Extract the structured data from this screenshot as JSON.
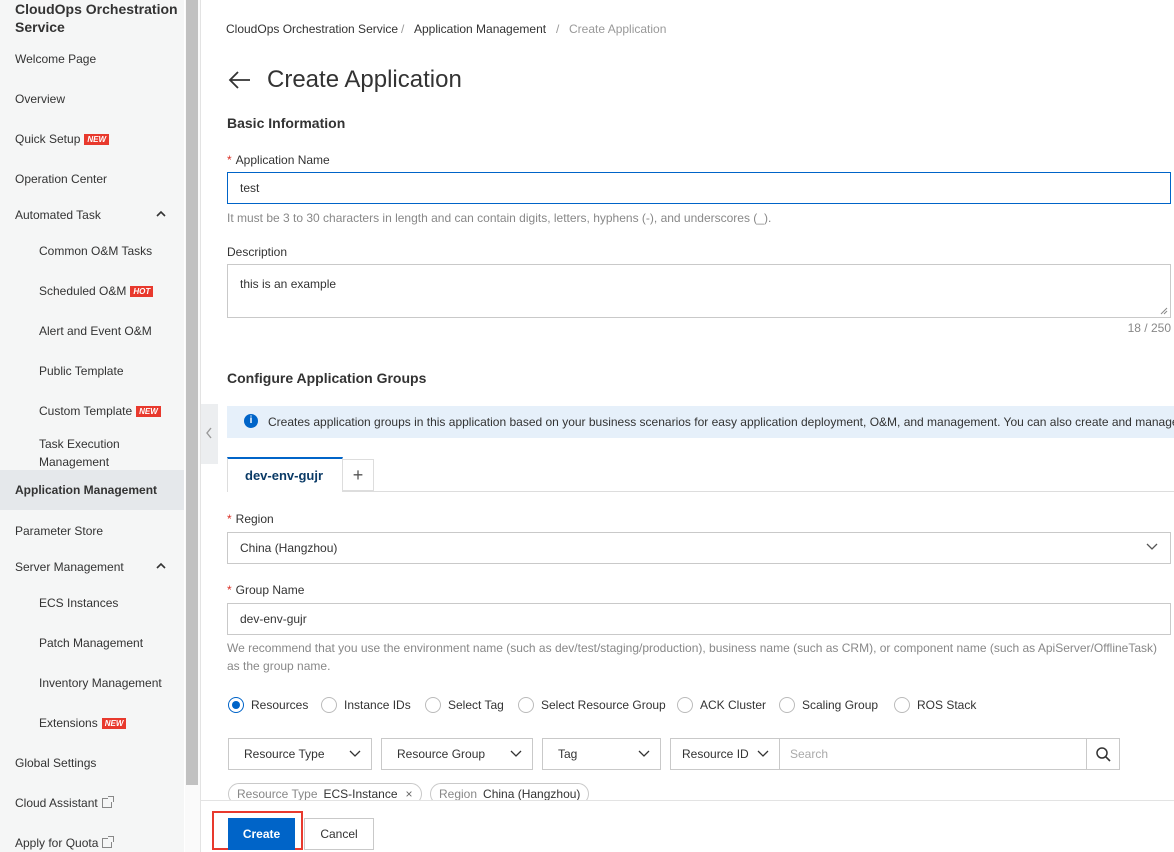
{
  "sidebar": {
    "title": "CloudOps Orchestration Service",
    "items": {
      "welcome": "Welcome Page",
      "overview": "Overview",
      "quick_setup": "Quick Setup",
      "operation_center": "Operation Center",
      "automated_task": "Automated Task",
      "common_om": "Common O&M Tasks",
      "scheduled_om": "Scheduled O&M",
      "alert_event_om": "Alert and Event O&M",
      "public_template": "Public Template",
      "custom_template": "Custom Template",
      "task_exec_line1": "Task Execution",
      "task_exec_line2": "Management",
      "app_management": "Application Management",
      "parameter_store": "Parameter Store",
      "server_management": "Server Management",
      "ecs_instances": "ECS Instances",
      "patch_management": "Patch Management",
      "inventory_management": "Inventory Management",
      "extensions": "Extensions",
      "global_settings": "Global Settings",
      "cloud_assistant": "Cloud Assistant",
      "apply_quota": "Apply for Quota"
    },
    "badges": {
      "new": "NEW",
      "hot": "HOT"
    }
  },
  "breadcrumb": [
    "CloudOps Orchestration Service",
    "Application Management",
    "Create Application"
  ],
  "breadcrumb_sep": "/",
  "page_title": "Create Application",
  "basic_info": {
    "heading": "Basic Information",
    "app_name_label": "Application Name",
    "app_name_value": "test",
    "app_name_help": "It must be 3 to 30 characters in length and can contain digits, letters, hyphens (-), and underscores (_).",
    "description_label": "Description",
    "description_value": "this is an example",
    "description_count": "18 / 250"
  },
  "groups": {
    "heading": "Configure Application Groups",
    "info": "Creates application groups in this application based on your business scenarios for easy application deployment, O&M, and management. You can also create and manage",
    "tab_label": "dev-env-gujr",
    "tab_add": "+",
    "region_label": "Region",
    "region_value": "China (Hangzhou)",
    "group_name_label": "Group Name",
    "group_name_value": "dev-env-gujr",
    "group_name_help": "We recommend that you use the environment name (such as dev/test/staging/production), business name (such as CRM), or component name (such as ApiServer/OfflineTask) as the group name.",
    "radio_options": [
      "Resources",
      "Instance IDs",
      "Select Tag",
      "Select Resource Group",
      "ACK Cluster",
      "Scaling Group",
      "ROS Stack"
    ],
    "radio_selected": "Resources",
    "filters": {
      "resource_type": "Resource Type",
      "resource_group": "Resource Group",
      "tag": "Tag",
      "resource_id": "Resource ID",
      "search_placeholder": "Search"
    },
    "chips": [
      {
        "key": "Resource Type",
        "value": "ECS-Instance",
        "close": "×"
      },
      {
        "key": "Region",
        "value": "China (Hangzhou)"
      }
    ]
  },
  "footer": {
    "create": "Create",
    "cancel": "Cancel"
  }
}
